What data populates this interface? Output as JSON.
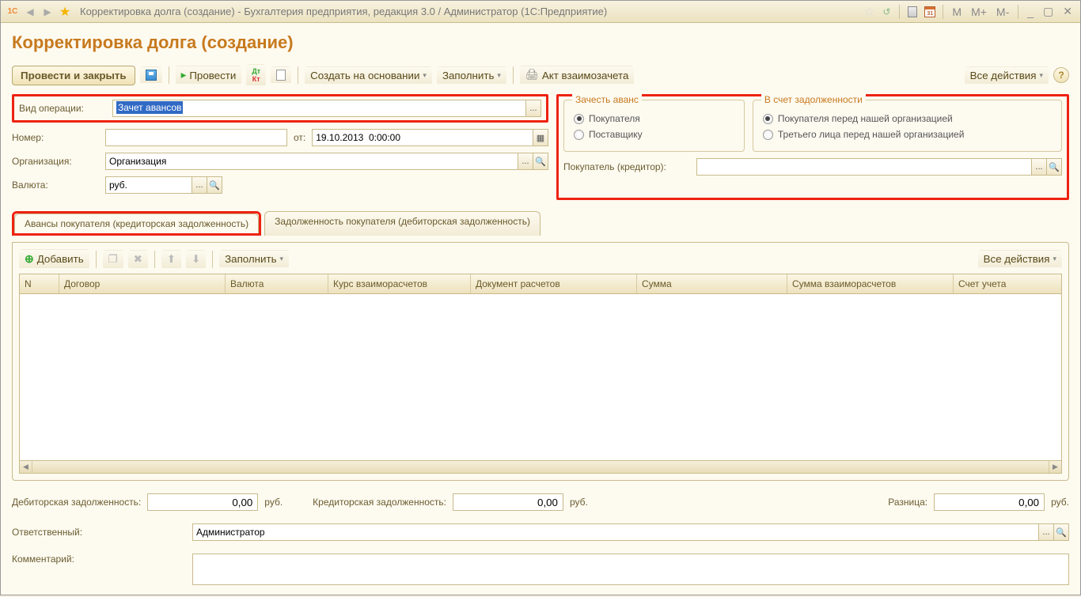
{
  "titlebar": {
    "title": "Корректировка долга (создание) - Бухгалтерия предприятия, редакция 3.0 / Администратор  (1С:Предприятие)",
    "m": "M",
    "mplus": "M+",
    "mminus": "M-",
    "min": "_",
    "max": "▢",
    "close": "✕"
  },
  "page": {
    "title": "Корректировка долга (создание)"
  },
  "toolbar": {
    "post_close": "Провести и закрыть",
    "post": "Провести",
    "create_based": "Создать на основании",
    "fill": "Заполнить",
    "act": "Акт взаимозачета",
    "all_actions": "Все действия"
  },
  "fields": {
    "operation_label": "Вид операции:",
    "operation_value": "Зачет авансов",
    "number_label": "Номер:",
    "number_value": "",
    "from_label": "от:",
    "date_value": "19.10.2013  0:00:00",
    "org_label": "Организация:",
    "org_value": "Организация",
    "currency_label": "Валюта:",
    "currency_value": "руб."
  },
  "group1": {
    "legend": "Зачесть аванс",
    "opt1": "Покупателя",
    "opt2": "Поставщику"
  },
  "group2": {
    "legend": "В счет задолженности",
    "opt1": "Покупателя перед нашей организацией",
    "opt2": "Третьего лица перед нашей организацией"
  },
  "buyer": {
    "label": "Покупатель (кредитор):",
    "value": ""
  },
  "tabs": {
    "t1": "Авансы покупателя (кредиторская задолженность)",
    "t2": "Задолженность покупателя (дебиторская задолженность)"
  },
  "tabtoolbar": {
    "add": "Добавить",
    "fill": "Заполнить",
    "all_actions": "Все действия"
  },
  "columns": {
    "n": "N",
    "contract": "Договор",
    "currency": "Валюта",
    "rate": "Курс взаиморасчетов",
    "doc": "Документ расчетов",
    "sum": "Сумма",
    "sum_calc": "Сумма взаиморасчетов",
    "account": "Счет учета"
  },
  "totals": {
    "debit_label": "Дебиторская задолженность:",
    "debit_value": "0,00",
    "debit_unit": "руб.",
    "credit_label": "Кредиторская задолженность:",
    "credit_value": "0,00",
    "credit_unit": "руб.",
    "diff_label": "Разница:",
    "diff_value": "0,00",
    "diff_unit": "руб."
  },
  "responsible": {
    "label": "Ответственный:",
    "value": "Администратор"
  },
  "comment": {
    "label": "Комментарий:",
    "value": ""
  },
  "icons": {
    "ellipsis": "...",
    "search": "🔍",
    "cal": "📅"
  }
}
